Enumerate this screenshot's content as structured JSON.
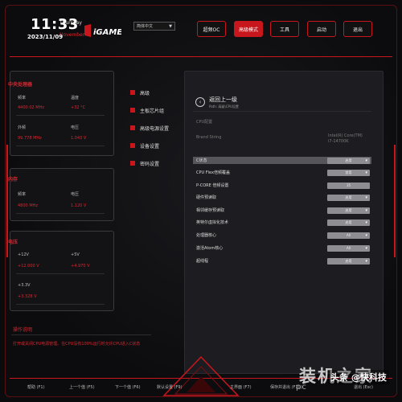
{
  "header": {
    "time": "11:33",
    "day": "Thursday",
    "date": "2023/11/09",
    "month": "November",
    "logo_text": "iGAME",
    "language": "简体中文",
    "tabs": [
      "超频OC",
      "高级模式",
      "工具",
      "启动",
      "退出"
    ],
    "active_tab": 1
  },
  "cpu_panel": {
    "title": "中央处理器",
    "freq_label": "频率",
    "temp_label": "温度",
    "freq_value": "4400.02 MHz",
    "temp_value": "+32 °C",
    "ext_label": "外频",
    "volt_label": "电压",
    "ext_value": "99.778 MHz",
    "volt_value": "1.043 V"
  },
  "mem_panel": {
    "title": "内存",
    "freq_label": "频率",
    "volt_label": "电压",
    "freq_value": "4800 MHz",
    "volt_value": "1.120 V"
  },
  "voltage_panel": {
    "title": "电压",
    "v12_label": "+12V",
    "v5_label": "+5V",
    "v12_value": "+12.000 V",
    "v5_value": "+4.970 V",
    "v33_label": "+3.3V",
    "v33_value": "+3.328 V"
  },
  "description": {
    "title": "操作说明",
    "text": "打开或关闭CPU电源管理。在CPU没有100%运行时允许CPU进入C状态"
  },
  "nav": [
    "高级",
    "主板芯片组",
    "高级电源设置",
    "设备设置",
    "密码设置"
  ],
  "main": {
    "back_label": "返回上一级",
    "path_label": "Path: 高级\\CPU设置",
    "section": "CPU配置",
    "brand_label": "Brand String",
    "brand_value_1": "Intel(R) Core(TM)",
    "brand_value_2": "i7-14700K",
    "rows": [
      {
        "label": "C状态",
        "value": "启用"
      },
      {
        "label": "CPU Flex倍频覆盖",
        "value": "禁用"
      },
      {
        "label": "P-CORE 倍频设置",
        "value": "35"
      },
      {
        "label": "硬件预读取",
        "value": "启用"
      },
      {
        "label": "相邻缓存预读取",
        "value": "启用"
      },
      {
        "label": "英特尔虚拟化技术",
        "value": "启用"
      },
      {
        "label": "处理器核心",
        "value": "All"
      },
      {
        "label": "激活Atom核心",
        "value": "All"
      },
      {
        "label": "超线程",
        "value": "启用"
      }
    ],
    "selected_row": 0
  },
  "footer": [
    "帮助 (F1)",
    "上一个值 (F5)",
    "下一个值 (F6)",
    "默认设置 (F9)",
    "主界面 (F7)",
    "保存并退出 (F10)",
    "退出 (Esc)"
  ],
  "watermark": {
    "brand": "装机之家",
    "site": "pc",
    "badge": "头条 @快科技"
  }
}
